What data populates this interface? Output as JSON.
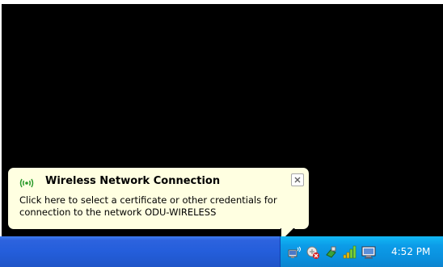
{
  "notification": {
    "title": "Wireless Network Connection",
    "body": "Click here to select a certificate or other credentials for connection to the network ODU-WIRELESS",
    "icon": "wireless-network-icon",
    "close_icon": "close-icon"
  },
  "taskbar": {
    "clock": "4:52 PM",
    "tray_icons": [
      "wireless-network-icon",
      "security-alert-icon",
      "network-connection-icon",
      "signal-strength-icon",
      "display-icon"
    ]
  },
  "colors": {
    "desktop": "#000000",
    "balloon_background": "#ffffe1",
    "taskbar": "#245edb",
    "tray": "#0c9ce8"
  }
}
